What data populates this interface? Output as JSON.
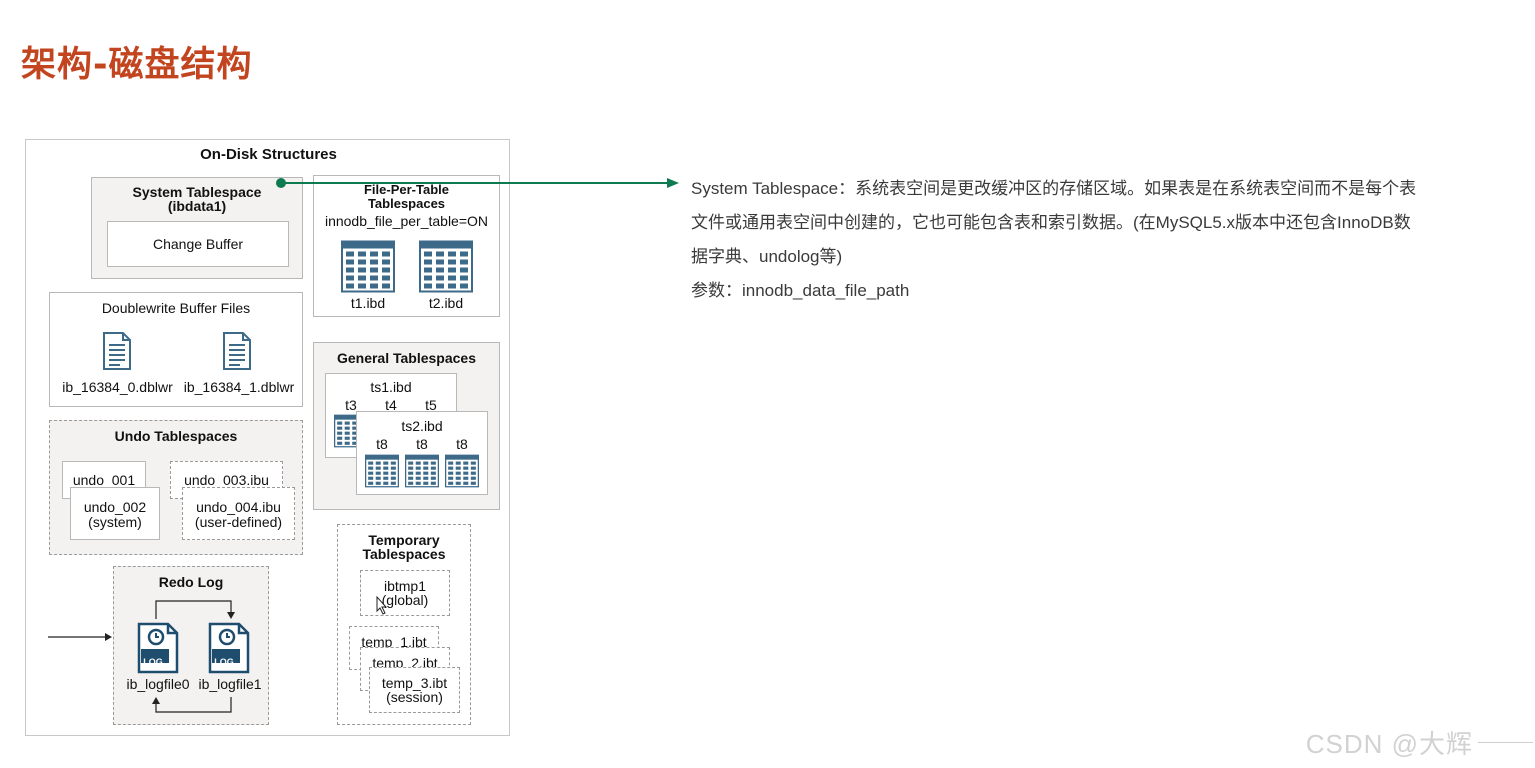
{
  "page": {
    "title": "架构-磁盘结构"
  },
  "diagram": {
    "title": "On-Disk Structures",
    "system_tablespace": {
      "title": "System Tablespace",
      "subtitle": "(ibdata1)",
      "change_buffer": "Change Buffer"
    },
    "file_per_table": {
      "title_line1": "File-Per-Table",
      "title_line2": "Tablespaces",
      "setting": "innodb_file_per_table=ON",
      "files": [
        "t1.ibd",
        "t2.ibd"
      ]
    },
    "doublewrite": {
      "title": "Doublewrite Buffer Files",
      "files": [
        "ib_16384_0.dblwr",
        "ib_16384_1.dblwr"
      ]
    },
    "general": {
      "title": "General Tablespaces",
      "ts1": "ts1.ibd",
      "ts1_tables": [
        "t3",
        "t4",
        "t5"
      ],
      "ts2": "ts2.ibd",
      "ts2_tables": [
        "t8",
        "t8",
        "t8"
      ]
    },
    "undo": {
      "title": "Undo Tablespaces",
      "undo_001": "undo_001",
      "undo_002": "undo_002",
      "undo_002_note": "(system)",
      "undo_003": "undo_003.ibu",
      "undo_004": "undo_004.ibu",
      "undo_004_note": "(user-defined)"
    },
    "redo": {
      "title": "Redo Log",
      "log_label": "LOG",
      "files": [
        "ib_logfile0",
        "ib_logfile1"
      ]
    },
    "temporary": {
      "title_line1": "Temporary",
      "title_line2": "Tablespaces",
      "ibtmp1": "ibtmp1",
      "ibtmp1_note": "(global)",
      "temp1": "temp_1.ibt",
      "temp2": "temp_2.ibt",
      "temp3": "temp_3.ibt",
      "temp3_note": "(session)"
    }
  },
  "description": {
    "line1": "System Tablespace：系统表空间是更改缓冲区的存储区域。如果表是在系统表空间而不是每个表",
    "line2": "文件或通用表空间中创建的，它也可能包含表和索引数据。(在MySQL5.x版本中还包含InnoDB数",
    "line3": "据字典、undolog等)",
    "param": "参数：innodb_data_file_path"
  },
  "watermark": "CSDN @大辉",
  "colors": {
    "title": "#c3451f",
    "pointer": "#0e7a4f",
    "icon": "#3e6a8a"
  }
}
